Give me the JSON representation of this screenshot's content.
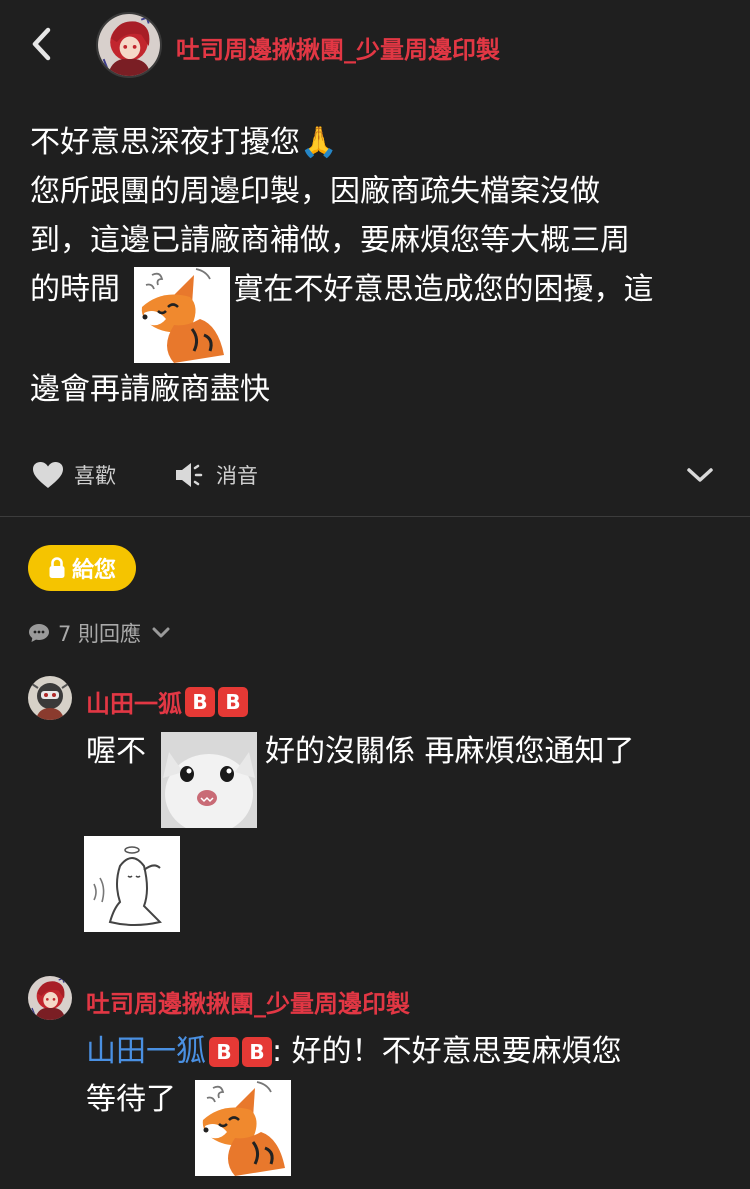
{
  "header": {
    "back_icon": "chevron-left-icon",
    "title": "吐司周邊揪揪團_少量周邊印製",
    "title_color": "#e23744"
  },
  "post": {
    "line1": "不好意思深夜打擾您",
    "line1_emoji": "🙏",
    "line2": "您所跟團的周邊印製，因廠商疏失檔案沒做",
    "line3": "到，這邊已請廠商補做，要麻煩您等大概三周",
    "line4_before": "的時間",
    "line4_after": "實在不好意思造成您的困擾，這",
    "line5": "邊會再請廠商盡快"
  },
  "actions": {
    "like_label": "喜歡",
    "mute_label": "消音",
    "expand_icon": "chevron-down-icon"
  },
  "give_button": {
    "label": "給您",
    "color": "#f5c400"
  },
  "replies": {
    "count_label": "7 則回應"
  },
  "comments": [
    {
      "author": "山田一狐",
      "badge1": "B",
      "badge2": "B",
      "text_before": "喔不",
      "text_after": "好的沒關係 再麻煩您通知了"
    },
    {
      "author": "吐司周邊揪揪團_少量周邊印製",
      "mention": "山田一狐",
      "badge1": "B",
      "badge2": "B",
      "text_line1": ": 好的！不好意思要麻煩您",
      "text_line2": "等待了"
    }
  ],
  "colors": {
    "background": "#1f1f1f",
    "name_red": "#e23744",
    "mention_blue": "#4a90e2",
    "badge_red": "#e53935"
  }
}
